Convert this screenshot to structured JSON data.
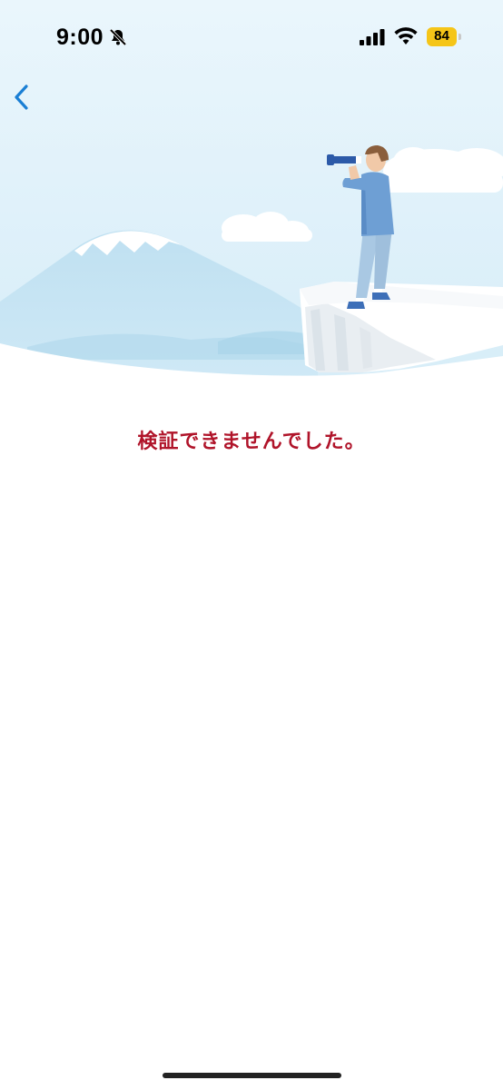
{
  "status_bar": {
    "time": "9:00",
    "battery_level": "84",
    "icons": [
      "bell-slash-icon",
      "cellular-signal-icon",
      "wifi-icon",
      "battery-icon"
    ],
    "battery_color": "#f5c518"
  },
  "nav": {
    "back_icon": "chevron-left-icon",
    "accent_color": "#1a7fd4"
  },
  "hero": {
    "illustration": "person-with-telescope-on-cliff-illustration"
  },
  "message": {
    "text": "検証できませんでした。",
    "color": "#b0142a"
  }
}
